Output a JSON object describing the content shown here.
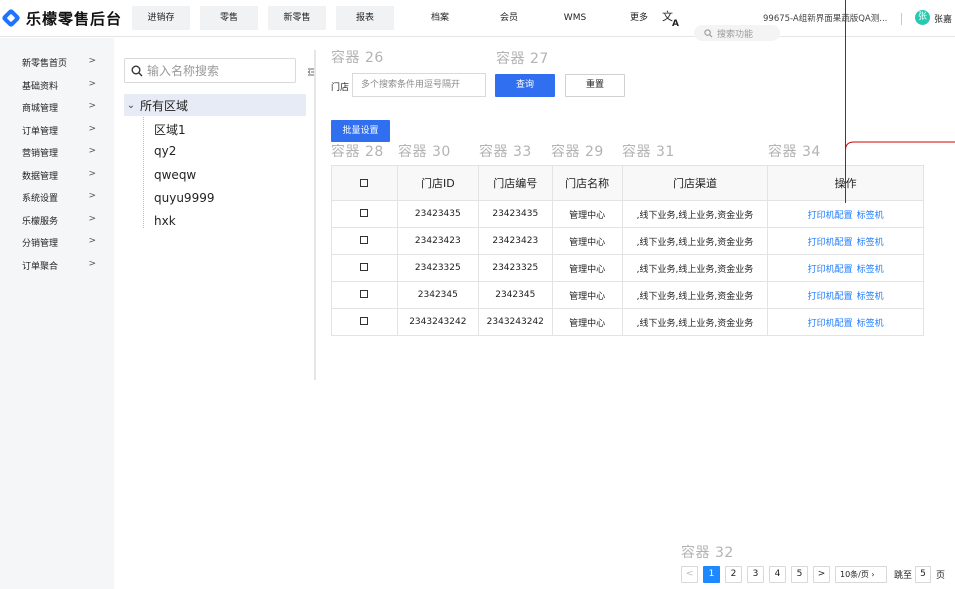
{
  "app": {
    "title": "乐檬零售后台"
  },
  "topnav": [
    {
      "label": "进销存",
      "boxed": true,
      "width": 58
    },
    {
      "label": "零售",
      "boxed": true,
      "width": 58
    },
    {
      "label": "新零售",
      "boxed": true,
      "width": 58
    },
    {
      "label": "报表",
      "boxed": true,
      "width": 58
    },
    {
      "label": "档案",
      "boxed": false,
      "width": 72
    },
    {
      "label": "会员",
      "boxed": false,
      "width": 66
    },
    {
      "label": "WMS",
      "boxed": false,
      "width": 66
    },
    {
      "label": "更多",
      "boxed": false,
      "width": 62
    }
  ],
  "header": {
    "search_placeholder": "搜索功能",
    "tenant": "99675-A组新界面果蔬版QA测...",
    "avatar_initial": "张",
    "username": "张嘉"
  },
  "sidebar": {
    "items": [
      {
        "label": "新零售首页",
        "chevron": ">"
      },
      {
        "label": "基础资料",
        "chevron": ">"
      },
      {
        "label": "商城管理",
        "chevron": ">"
      },
      {
        "label": "订单管理",
        "chevron": ">"
      },
      {
        "label": "营销管理",
        "chevron": ">"
      },
      {
        "label": "数据管理",
        "chevron": ">"
      },
      {
        "label": "系统设置",
        "chevron": ">"
      },
      {
        "label": "乐檬服务",
        "chevron": ">"
      },
      {
        "label": "分销管理",
        "chevron": ">"
      },
      {
        "label": "订单聚合",
        "chevron": ">"
      }
    ]
  },
  "tree": {
    "search_placeholder": "输入名称搜索",
    "root": "所有区域",
    "nodes": [
      "区域1",
      "qy2",
      "qweqw",
      "quyu9999",
      "hxk"
    ]
  },
  "containers": {
    "c26": "容器 26",
    "c27": "容器 27",
    "c28": "容器 28",
    "c30": "容器 30",
    "c33": "容器 33",
    "c29": "容器 29",
    "c31": "容器 31",
    "c34": "容器 34",
    "c32": "容器 32"
  },
  "filter": {
    "label": "门店",
    "placeholder": "多个搜索条件用逗号隔开",
    "query_label": "查询",
    "reset_label": "重置",
    "batch_label": "批量设置"
  },
  "table": {
    "headers": [
      "口",
      "门店ID",
      "门店编号",
      "门店名称",
      "门店渠道",
      "操作"
    ],
    "rows": [
      {
        "check": "口",
        "id": "23423435",
        "code": "23423435",
        "name": "管理中心",
        "channel": ",线下业务,线上业务,资金业务",
        "action1": "打印机配置",
        "action2": "标签机"
      },
      {
        "check": "口",
        "id": "23423423",
        "code": "23423423",
        "name": "管理中心",
        "channel": ",线下业务,线上业务,资金业务",
        "action1": "打印机配置",
        "action2": "标签机"
      },
      {
        "check": "口",
        "id": "23423325",
        "code": "23423325",
        "name": "管理中心",
        "channel": ",线下业务,线上业务,资金业务",
        "action1": "打印机配置",
        "action2": "标签机"
      },
      {
        "check": "口",
        "id": "2342345",
        "code": "2342345",
        "name": "管理中心",
        "channel": ",线下业务,线上业务,资金业务",
        "action1": "打印机配置",
        "action2": "标签机"
      },
      {
        "check": "口",
        "id": "2343243242",
        "code": "2343243242",
        "name": "管理中心",
        "channel": ",线下业务,线上业务,资金业务",
        "action1": "打印机配置",
        "action2": "标签机"
      }
    ]
  },
  "pagination": {
    "prev": "<",
    "pages": [
      "1",
      "2",
      "3",
      "4",
      "5"
    ],
    "current": "1",
    "next": ">",
    "page_size": "10条/页",
    "jump_label": "跳至",
    "jump_value": "5",
    "page_suffix": "页"
  },
  "colors": {
    "primary": "#2f6ff0",
    "link": "#1e7bff",
    "connector": "#d40000",
    "avatar": "#28c9b0"
  }
}
